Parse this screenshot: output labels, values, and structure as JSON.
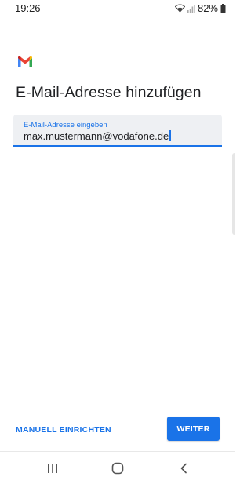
{
  "status_bar": {
    "time": "19:26",
    "battery_percent": "82%",
    "icons": [
      "wifi-icon",
      "signal-icon",
      "battery-icon"
    ]
  },
  "app": {
    "logo": "gmail-logo"
  },
  "title": "E-Mail-Adresse hinzufügen",
  "email_field": {
    "label": "E-Mail-Adresse eingeben",
    "value": "max.mustermann@vodafone.de"
  },
  "actions": {
    "manual_setup": "MANUELL EINRICHTEN",
    "next": "WEITER"
  },
  "nav_bar": {
    "icons": [
      "recent-apps-icon",
      "home-icon",
      "back-icon"
    ]
  },
  "colors": {
    "accent": "#1a73e8",
    "field_background": "#eef0f3",
    "text": "#202124"
  }
}
